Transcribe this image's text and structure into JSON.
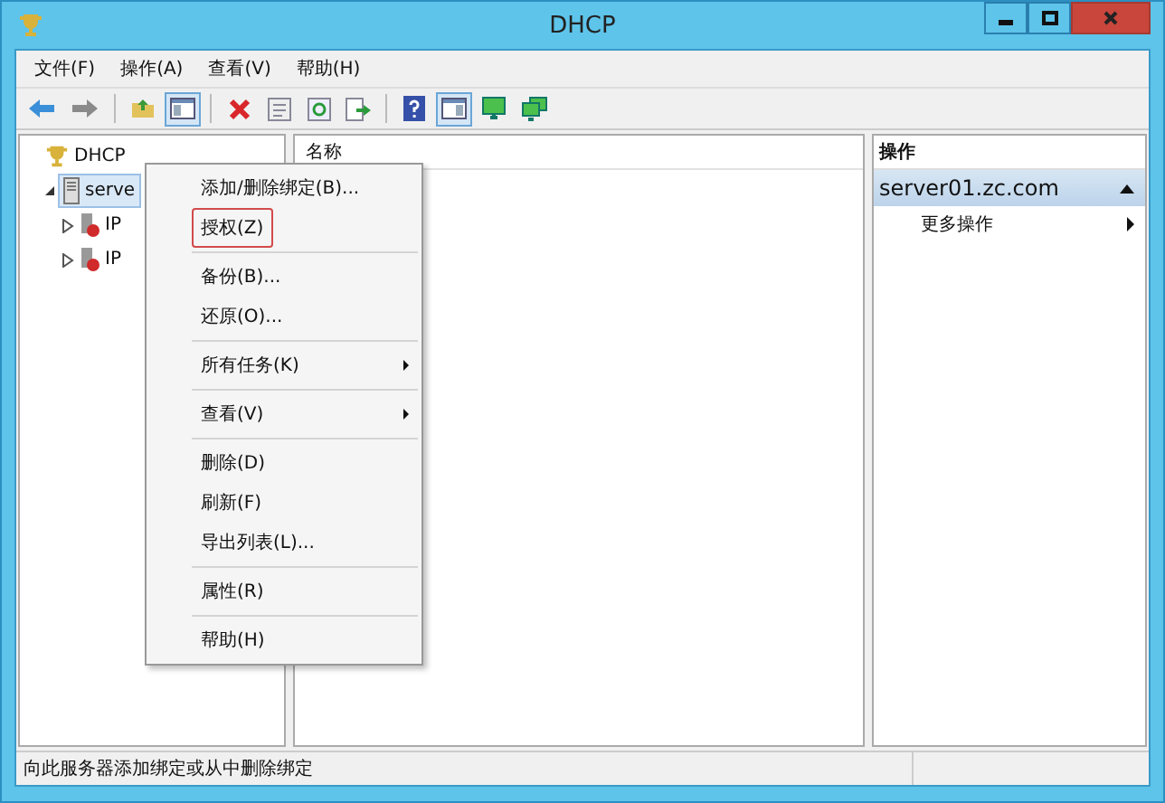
{
  "window": {
    "title": "DHCP"
  },
  "menu_bar": [
    "文件(F)",
    "操作(A)",
    "查看(V)",
    "帮助(H)"
  ],
  "toolbar": [
    {
      "kind": "back",
      "pressed": false
    },
    {
      "kind": "forward",
      "pressed": false
    },
    {
      "kind": "separator"
    },
    {
      "kind": "up",
      "pressed": false
    },
    {
      "kind": "tree",
      "pressed": true
    },
    {
      "kind": "separator"
    },
    {
      "kind": "delete",
      "pressed": false
    },
    {
      "kind": "properties",
      "pressed": false
    },
    {
      "kind": "refresh",
      "pressed": false
    },
    {
      "kind": "export",
      "pressed": false
    },
    {
      "kind": "separator"
    },
    {
      "kind": "help",
      "pressed": false
    },
    {
      "kind": "pane",
      "pressed": true
    },
    {
      "kind": "monitor",
      "pressed": false
    },
    {
      "kind": "monitors",
      "pressed": false
    }
  ],
  "tree": [
    {
      "label": "DHCP",
      "kind": "root",
      "selected": false,
      "children": [
        {
          "label": "serve",
          "kind": "server",
          "expanded": true,
          "selected": true,
          "children": [
            {
              "label": "IP",
              "kind": "scope",
              "expanded": false,
              "selected": false
            },
            {
              "label": "IP",
              "kind": "scope",
              "expanded": false,
              "selected": false
            }
          ]
        }
      ]
    }
  ],
  "list": {
    "columns": [
      "名称"
    ]
  },
  "actions": {
    "header": "操作",
    "section": "server01.zc.com",
    "expanded": true,
    "items": [
      "更多操作"
    ]
  },
  "context_menu": [
    [
      {
        "label": "添加/删除绑定(B)...",
        "selected": false,
        "submenu": false
      },
      {
        "label": "授权(Z)",
        "selected": true,
        "submenu": false
      }
    ],
    [
      {
        "label": "备份(B)...",
        "selected": false,
        "submenu": false
      },
      {
        "label": "还原(O)...",
        "selected": false,
        "submenu": false
      }
    ],
    [
      {
        "label": "所有任务(K)",
        "selected": false,
        "submenu": true
      }
    ],
    [
      {
        "label": "查看(V)",
        "selected": false,
        "submenu": true
      }
    ],
    [
      {
        "label": "删除(D)",
        "selected": false,
        "submenu": false
      },
      {
        "label": "刷新(F)",
        "selected": false,
        "submenu": false
      },
      {
        "label": "导出列表(L)...",
        "selected": false,
        "submenu": false
      }
    ],
    [
      {
        "label": "属性(R)",
        "selected": false,
        "submenu": false
      }
    ],
    [
      {
        "label": "帮助(H)",
        "selected": false,
        "submenu": false
      }
    ]
  ],
  "status_bar": "向此服务器添加绑定或从中删除绑定"
}
